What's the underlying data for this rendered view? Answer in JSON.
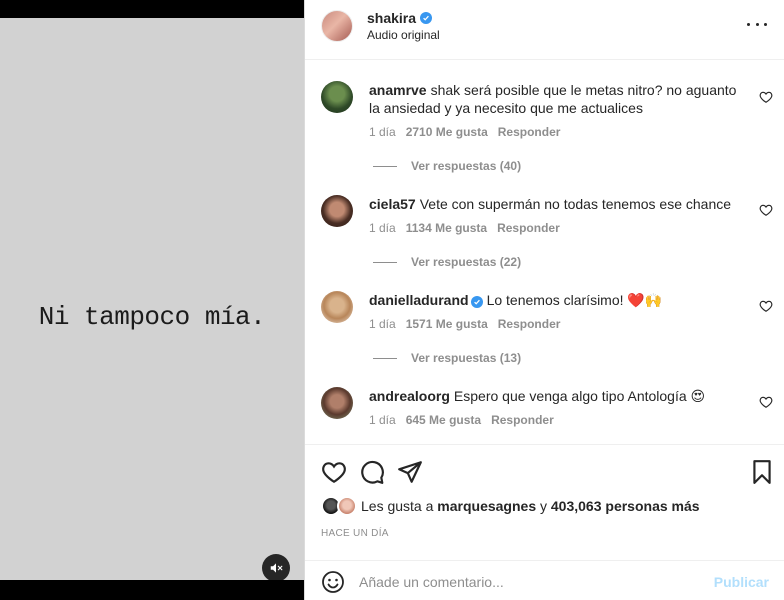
{
  "media": {
    "caption": "Ni tampoco mía.",
    "mute_icon": "speaker-muted-icon"
  },
  "header": {
    "username": "shakira",
    "subtitle": "Audio original",
    "verified_color": "#3897f0"
  },
  "comments": [
    {
      "handle": "anamrve",
      "text": "shak será posible que le metas nitro? no aguanto la ansiedad y ya necesito que me actualices",
      "time": "1 día",
      "likes": "2710 Me gusta",
      "reply": "Responder",
      "view_replies": "Ver respuestas (40)"
    },
    {
      "handle": "ciela57",
      "text": "Vete con supermán no todas tenemos ese chance",
      "time": "1 día",
      "likes": "1134 Me gusta",
      "reply": "Responder",
      "view_replies": "Ver respuestas (22)"
    },
    {
      "handle": "danielladurand",
      "text": "Lo tenemos clarísimo! ❤️🙌",
      "time": "1 día",
      "likes": "1571 Me gusta",
      "reply": "Responder",
      "view_replies": "Ver respuestas (13)"
    },
    {
      "handle": "andrealoorg",
      "text": "Espero que venga algo tipo Antología 😍",
      "time": "1 día",
      "likes": "645 Me gusta",
      "reply": "Responder"
    }
  ],
  "likes": {
    "prefix": "Les gusta a",
    "user": "marquesagnes",
    "connector": "y",
    "others": "403,063 personas más"
  },
  "timestamp": "HACE UN DÍA",
  "composer": {
    "placeholder": "Añade un comentario...",
    "post_label": "Publicar",
    "post_color": "#b2dffc"
  }
}
